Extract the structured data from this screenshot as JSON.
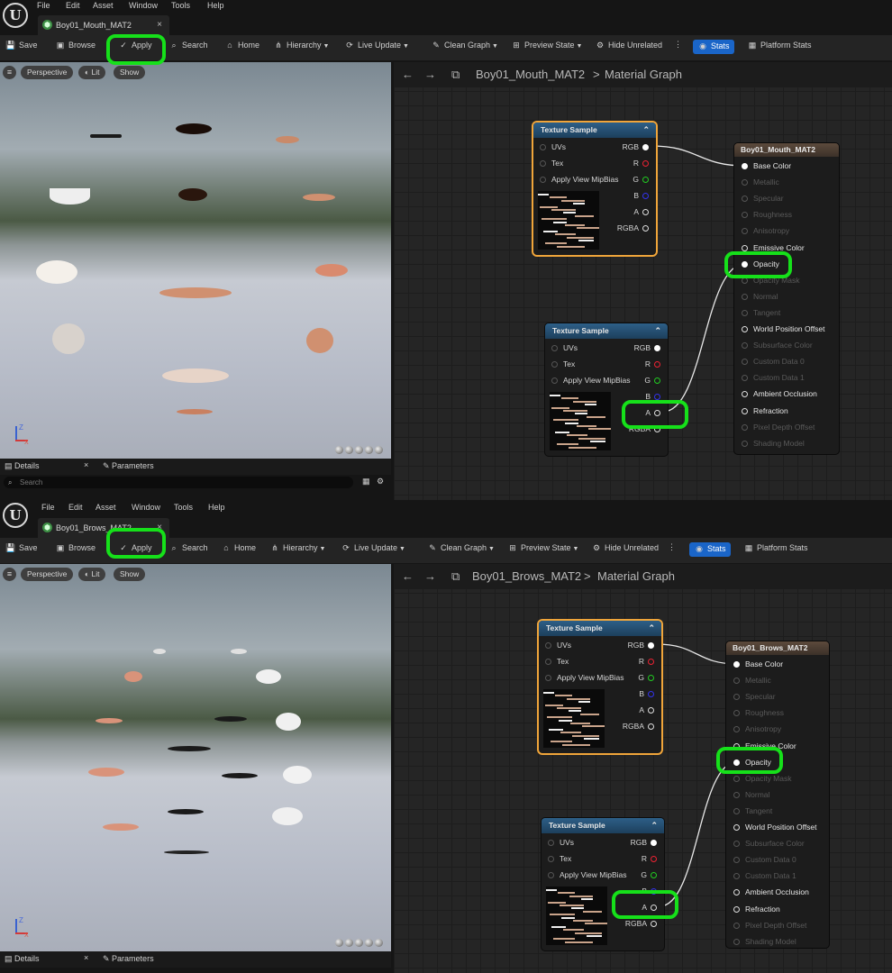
{
  "menu": [
    "File",
    "Edit",
    "Asset",
    "Window",
    "Tools",
    "Help"
  ],
  "logo": "U",
  "editors": [
    {
      "tab_title": "Boy01_Mouth_MAT2",
      "toolbar": {
        "save": "Save",
        "browse": "Browse",
        "apply": "Apply",
        "search": "Search",
        "home": "Home",
        "hierarchy": "Hierarchy",
        "live_update": "Live Update",
        "clean_graph": "Clean Graph",
        "preview_state": "Preview State",
        "hide_unrelated": "Hide Unrelated",
        "stats": "Stats",
        "platform_stats": "Platform Stats"
      },
      "viewport": {
        "perspective": "Perspective",
        "lit": "Lit",
        "show": "Show"
      },
      "panels": {
        "details": "Details",
        "parameters": "Parameters",
        "search_placeholder": "Search"
      },
      "breadcrumb": {
        "asset": "Boy01_Mouth_MAT2",
        "separator": ">",
        "graph": "Material Graph"
      },
      "texture_node": {
        "title": "Texture Sample",
        "inputs": [
          "UVs",
          "Tex",
          "Apply View MipBias"
        ],
        "outputs": [
          "RGB",
          "R",
          "G",
          "B",
          "A",
          "RGBA"
        ]
      },
      "material_node": {
        "title": "Boy01_Mouth_MAT2",
        "pins": [
          {
            "label": "Base Color",
            "active": true
          },
          {
            "label": "Metallic",
            "active": false
          },
          {
            "label": "Specular",
            "active": false
          },
          {
            "label": "Roughness",
            "active": false
          },
          {
            "label": "Anisotropy",
            "active": false
          },
          {
            "label": "Emissive Color",
            "active": true
          },
          {
            "label": "Opacity",
            "active": true
          },
          {
            "label": "Opacity Mask",
            "active": false
          },
          {
            "label": "Normal",
            "active": false
          },
          {
            "label": "Tangent",
            "active": false
          },
          {
            "label": "World Position Offset",
            "active": true
          },
          {
            "label": "Subsurface Color",
            "active": false
          },
          {
            "label": "Custom Data 0",
            "active": false
          },
          {
            "label": "Custom Data 1",
            "active": false
          },
          {
            "label": "Ambient Occlusion",
            "active": true
          },
          {
            "label": "Refraction",
            "active": true
          },
          {
            "label": "Pixel Depth Offset",
            "active": false
          },
          {
            "label": "Shading Model",
            "active": false
          }
        ]
      }
    },
    {
      "tab_title": "Boy01_Brows_MAT2",
      "toolbar": {
        "save": "Save",
        "browse": "Browse",
        "apply": "Apply",
        "search": "Search",
        "home": "Home",
        "hierarchy": "Hierarchy",
        "live_update": "Live Update",
        "clean_graph": "Clean Graph",
        "preview_state": "Preview State",
        "hide_unrelated": "Hide Unrelated",
        "stats": "Stats",
        "platform_stats": "Platform Stats"
      },
      "viewport": {
        "perspective": "Perspective",
        "lit": "Lit",
        "show": "Show"
      },
      "panels": {
        "details": "Details",
        "parameters": "Parameters",
        "search_placeholder": ""
      },
      "breadcrumb": {
        "asset": "Boy01_Brows_MAT2",
        "separator": ">",
        "graph": "Material Graph"
      },
      "texture_node": {
        "title": "Texture Sample",
        "inputs": [
          "UVs",
          "Tex",
          "Apply View MipBias"
        ],
        "outputs": [
          "RGB",
          "R",
          "G",
          "B",
          "A",
          "RGBA"
        ]
      },
      "material_node": {
        "title": "Boy01_Brows_MAT2",
        "pins": [
          {
            "label": "Base Color",
            "active": true
          },
          {
            "label": "Metallic",
            "active": false
          },
          {
            "label": "Specular",
            "active": false
          },
          {
            "label": "Roughness",
            "active": false
          },
          {
            "label": "Anisotropy",
            "active": false
          },
          {
            "label": "Emissive Color",
            "active": true
          },
          {
            "label": "Opacity",
            "active": true
          },
          {
            "label": "Opacity Mask",
            "active": false
          },
          {
            "label": "Normal",
            "active": false
          },
          {
            "label": "Tangent",
            "active": false
          },
          {
            "label": "World Position Offset",
            "active": true
          },
          {
            "label": "Subsurface Color",
            "active": false
          },
          {
            "label": "Custom Data 0",
            "active": false
          },
          {
            "label": "Custom Data 1",
            "active": false
          },
          {
            "label": "Ambient Occlusion",
            "active": true
          },
          {
            "label": "Refraction",
            "active": true
          },
          {
            "label": "Pixel Depth Offset",
            "active": false
          },
          {
            "label": "Shading Model",
            "active": false
          }
        ]
      }
    }
  ],
  "colors": {
    "highlight": "#16e01a",
    "selected_node": "#f0a53a",
    "stats_button": "#1a65c8",
    "node_header": "#2d5f87"
  }
}
